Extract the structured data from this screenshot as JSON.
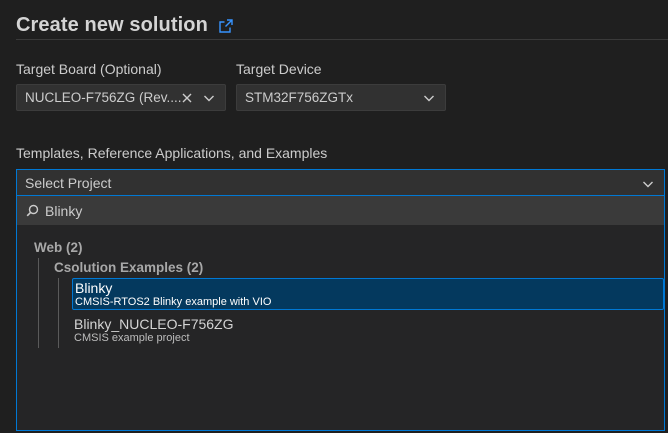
{
  "header": {
    "title": "Create new solution",
    "link_icon": "external-link-icon"
  },
  "target_board": {
    "label": "Target Board (Optional)",
    "value": "NUCLEO-F756ZG (Rev....",
    "clear_icon": "close-icon",
    "chevron_icon": "chevron-down-icon"
  },
  "target_device": {
    "label": "Target Device",
    "value": "STM32F756ZGTx",
    "chevron_icon": "chevron-down-icon"
  },
  "templates": {
    "label": "Templates, Reference Applications, and Examples",
    "select_value": "Select Project"
  },
  "picker": {
    "search_value": "Blinky",
    "groups": [
      {
        "label": "Web (2)",
        "subgroups": [
          {
            "label": "Csolution Examples (2)",
            "items": [
              {
                "name": "Blinky",
                "description": "CMSIS-RTOS2 Blinky example with VIO",
                "selected": true
              },
              {
                "name": "Blinky_NUCLEO-F756ZG",
                "description": "CMSIS example project",
                "selected": false
              }
            ]
          }
        ]
      }
    ]
  },
  "colors": {
    "accent": "#0078d4",
    "selection": "#04395e",
    "background": "#1f1f1f"
  }
}
